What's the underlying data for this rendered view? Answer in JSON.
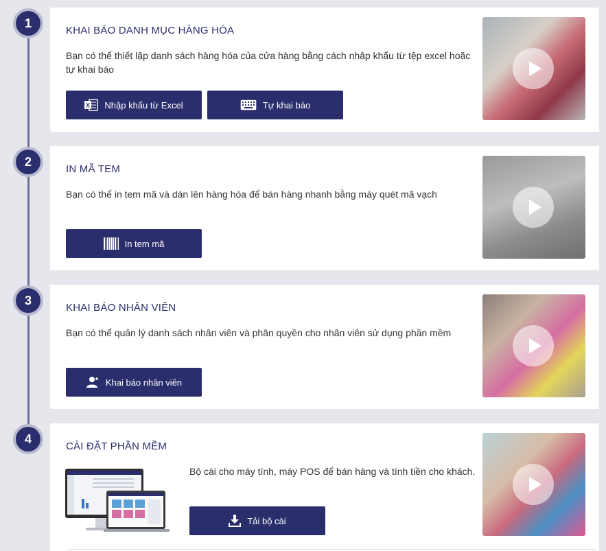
{
  "steps": [
    {
      "number": "1",
      "title": "KHAI BÁO DANH MỤC HÀNG HÓA",
      "description": "Bạn có thể thiết lập danh sách hàng hóa của cửa hàng bằng cách nhập khẩu từ tệp excel hoặc tự khai báo",
      "buttons": [
        {
          "label": "Nhập khẩu từ Excel",
          "icon": "excel-icon"
        },
        {
          "label": "Tự khai báo",
          "icon": "keyboard-icon"
        }
      ]
    },
    {
      "number": "2",
      "title": "IN MÃ TEM",
      "description": "Bạn có thể in tem mã và dán lên hàng hóa để bán hàng nhanh bằng máy quét mã vạch",
      "buttons": [
        {
          "label": "In tem mã",
          "icon": "barcode-icon"
        }
      ]
    },
    {
      "number": "3",
      "title": "KHAI BÁO NHÂN VIÊN",
      "description": "Bạn có thể quản lý danh sách nhân viên và phân quyền cho nhân viên sử dụng phần mềm",
      "buttons": [
        {
          "label": "Khai báo nhân viên",
          "icon": "add-user-icon"
        }
      ]
    },
    {
      "number": "4",
      "title": "CÀI ĐẶT PHẦN MỀM",
      "description": "Bộ cài cho máy tính, máy POS để bán hàng và tính tiền cho khách.",
      "buttons": [
        {
          "label": "Tải bộ cài",
          "icon": "download-icon"
        }
      ]
    }
  ],
  "colors": {
    "primary": "#2b2e6c",
    "background": "#e6e7ec",
    "card": "#ffffff"
  }
}
